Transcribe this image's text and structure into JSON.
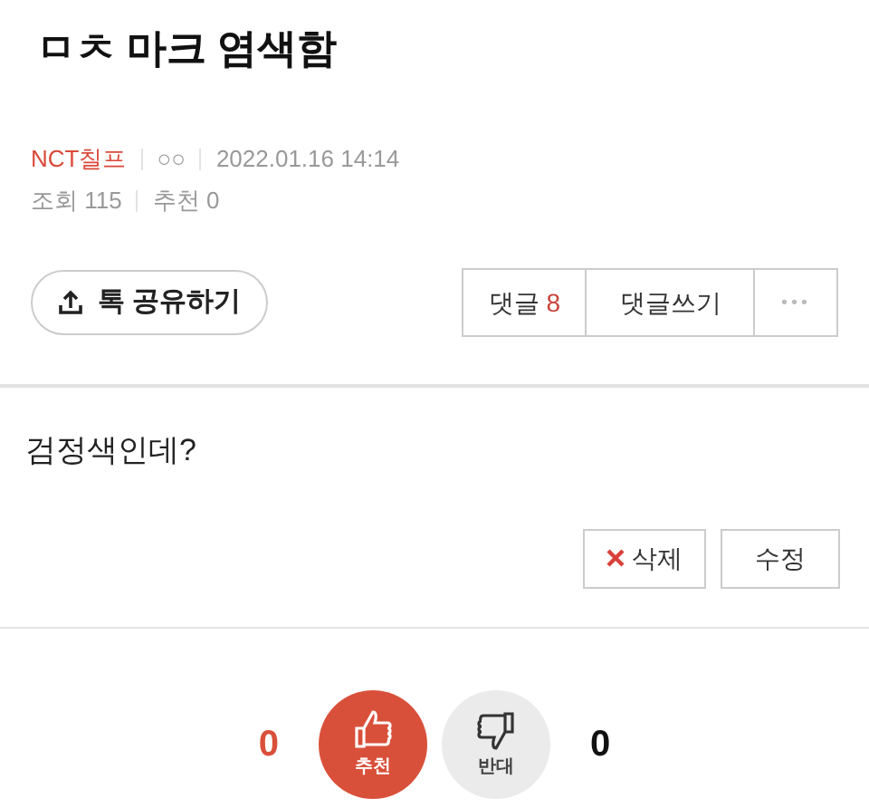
{
  "post": {
    "title": "ㅁㅊ 마크 염색함",
    "author": "NCT칠프",
    "author_level": "○○",
    "date": "2022.01.16 14:14",
    "views_label": "조회",
    "views": "115",
    "recommend_label": "추천",
    "recommend": "0"
  },
  "share_button": "톡 공유하기",
  "comment_buttons": {
    "comments_label": "댓글",
    "comments_count": "8",
    "write_label": "댓글쓰기",
    "more": "•••"
  },
  "body": "검정색인데?",
  "actions": [
    {
      "label": "삭제",
      "kind": "delete"
    },
    {
      "label": "수정",
      "kind": "edit"
    }
  ],
  "votes": [
    {
      "count": "0",
      "label": "추천",
      "kind": "up",
      "selected": true
    },
    {
      "count": "0",
      "label": "반대",
      "kind": "down",
      "selected": false
    }
  ]
}
